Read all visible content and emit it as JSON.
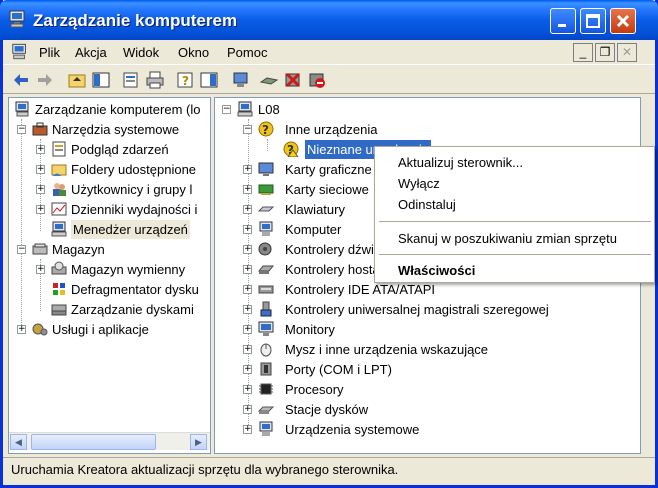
{
  "window": {
    "title": "Zarządzanie komputerem"
  },
  "menubar": {
    "items": [
      "Plik",
      "Akcja",
      "Widok",
      "Okno",
      "Pomoc"
    ]
  },
  "left_tree": {
    "root": "Zarządzanie komputerem (lo",
    "tools": "Narzędzia systemowe",
    "event_viewer": "Podgląd zdarzeń",
    "shared_folders": "Foldery udostępnione",
    "users_groups": "Użytkownicy i grupy l",
    "perf_logs": "Dzienniki wydajności i",
    "device_manager": "Menedżer urządzeń",
    "storage": "Magazyn",
    "removable": "Magazyn wymienny",
    "defrag": "Defragmentator dysku",
    "disk_mgmt": "Zarządzanie dyskami",
    "services": "Usługi i aplikacje"
  },
  "right_tree": {
    "root": "L08",
    "other": "Inne urządzenia",
    "unknown": "Nieznane urządzenie",
    "display": "Karty graficzne",
    "network": "Karty sieciowe",
    "keyboards": "Klawiatury",
    "computer": "Komputer",
    "sound": "Kontrolery dźwięku",
    "host": "Kontrolery hosta",
    "ide": "Kontrolery IDE ATA/ATAPI",
    "usb": "Kontrolery uniwersalnej magistrali szeregowej",
    "monitors": "Monitory",
    "mice": "Mysz i inne urządzenia wskazujące",
    "ports": "Porty (COM i LPT)",
    "processors": "Procesory",
    "disk_drives": "Stacje dysków",
    "system": "Urządzenia systemowe"
  },
  "context_menu": {
    "update": "Aktualizuj sterownik...",
    "disable": "Wyłącz",
    "uninstall": "Odinstaluj",
    "scan": "Skanuj w poszukiwaniu zmian sprzętu",
    "properties": "Właściwości"
  },
  "status": {
    "text": "Uruchamia Kreatora aktualizacji sprzętu dla wybranego sterownika."
  }
}
